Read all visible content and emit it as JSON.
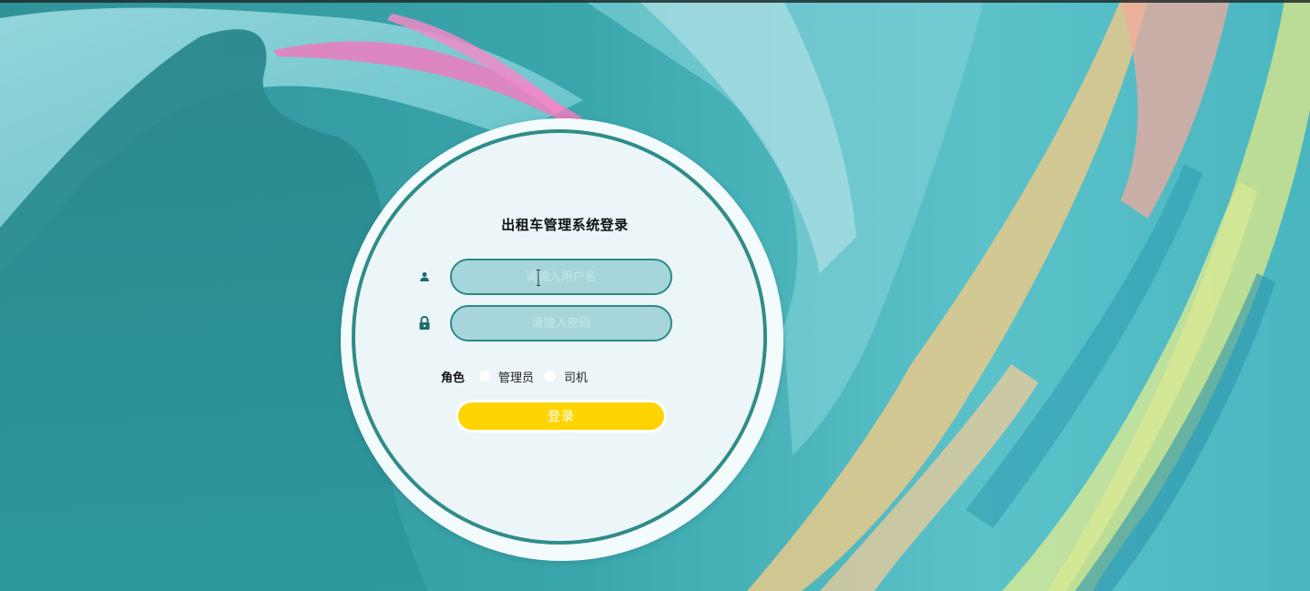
{
  "login": {
    "title": "出租车管理系统登录",
    "username_placeholder": "请输入用户名",
    "password_placeholder": "请输入密码",
    "role_label": "角色",
    "roles": [
      "管理员",
      "司机"
    ],
    "submit_label": "登录"
  },
  "icons": {
    "user": "user-icon",
    "lock": "lock-icon"
  },
  "colors": {
    "accent": "#2f8c89",
    "input_fill": "#a6d6dc",
    "button": "#ffd400"
  }
}
